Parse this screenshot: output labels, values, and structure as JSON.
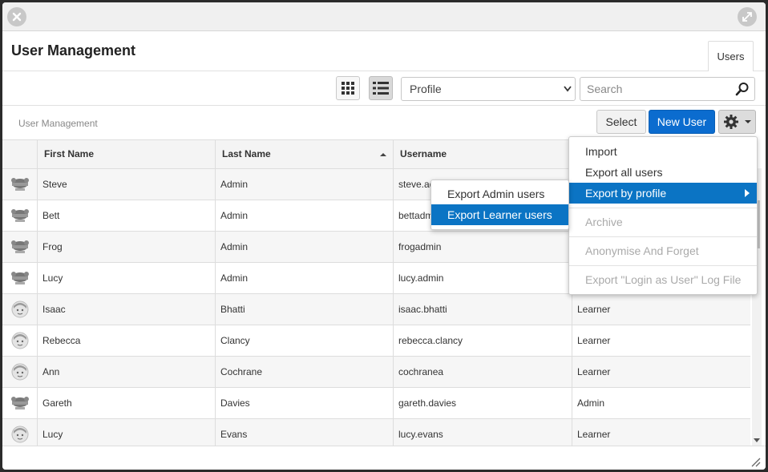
{
  "window": {
    "close_icon": "close-icon",
    "expand_icon": "expand-icon"
  },
  "header": {
    "title": "User Management",
    "tab": "Users"
  },
  "toolbar": {
    "grid_view_icon": "grid-icon",
    "list_view_icon": "list-icon",
    "profile_select_value": "Profile",
    "search_placeholder": "Search"
  },
  "actions": {
    "breadcrumb": "User Management",
    "select_label": "Select",
    "new_user_label": "New User",
    "gear_icon": "gear-icon"
  },
  "table": {
    "columns": [
      "First Name",
      "Last Name",
      "Username",
      ""
    ],
    "sorted_column": "Last Name",
    "rows": [
      {
        "first": "Steve",
        "last": "Admin",
        "username": "steve.ad",
        "profile": "",
        "avatar": "admin"
      },
      {
        "first": "Bett",
        "last": "Admin",
        "username": "bettadm",
        "profile": "",
        "avatar": "admin"
      },
      {
        "first": "Frog",
        "last": "Admin",
        "username": "frogadmin",
        "profile": "",
        "avatar": "admin"
      },
      {
        "first": "Lucy",
        "last": "Admin",
        "username": "lucy.admin",
        "profile": "",
        "avatar": "admin"
      },
      {
        "first": "Isaac",
        "last": "Bhatti",
        "username": "isaac.bhatti",
        "profile": "Learner",
        "avatar": "learner"
      },
      {
        "first": "Rebecca",
        "last": "Clancy",
        "username": "rebecca.clancy",
        "profile": "Learner",
        "avatar": "learner"
      },
      {
        "first": "Ann",
        "last": "Cochrane",
        "username": "cochranea",
        "profile": "Learner",
        "avatar": "learner"
      },
      {
        "first": "Gareth",
        "last": "Davies",
        "username": "gareth.davies",
        "profile": "Admin",
        "avatar": "admin"
      },
      {
        "first": "Lucy",
        "last": "Evans",
        "username": "lucy.evans",
        "profile": "Learner",
        "avatar": "learner"
      }
    ]
  },
  "gear_menu": {
    "items": [
      {
        "label": "Import",
        "disabled": false
      },
      {
        "label": "Export all users",
        "disabled": false
      },
      {
        "label": "Export by profile",
        "disabled": false,
        "active": true
      },
      {
        "label": "Archive",
        "disabled": true
      },
      {
        "label": "Anonymise And Forget",
        "disabled": true
      },
      {
        "label": "Export \"Login as User\" Log File",
        "disabled": true
      }
    ]
  },
  "export_submenu": {
    "items": [
      {
        "label": "Export Admin users",
        "active": false
      },
      {
        "label": "Export Learner users",
        "active": true
      }
    ]
  },
  "colors": {
    "accent": "#0b6ccf",
    "menu_highlight": "#0b74c4"
  }
}
